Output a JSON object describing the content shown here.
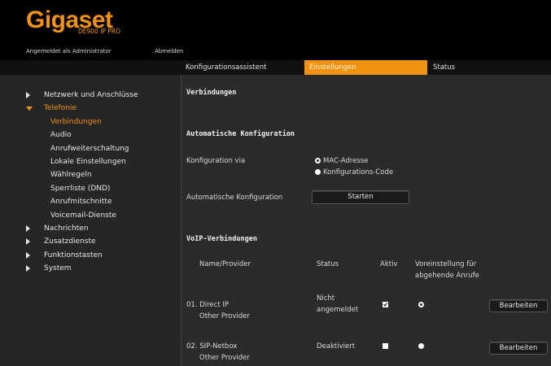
{
  "header": {
    "logo": "Gigaset",
    "model": "DE900 IP PRO",
    "login_info": "Angemeldet als Administrator",
    "logout": "Abmelden"
  },
  "tabs": [
    "Konfigurationsassistent",
    "Einstellungen",
    "Status"
  ],
  "sidebar": {
    "items": [
      {
        "label": "Netzwerk und Anschlüsse",
        "icon": "arrow-right-icon"
      },
      {
        "label": "Telefonie",
        "icon": "arrow-down-icon"
      },
      {
        "label": "Verbindungen"
      },
      {
        "label": "Audio"
      },
      {
        "label": "Anrufweiterschaltung"
      },
      {
        "label": "Lokale Einstellungen"
      },
      {
        "label": "Wählregeln"
      },
      {
        "label": "Sperrliste (DND)"
      },
      {
        "label": "Anrufmitschnitte"
      },
      {
        "label": "Voicemail-Dienste"
      },
      {
        "label": "Nachrichten",
        "icon": "arrow-right-icon"
      },
      {
        "label": "Zusatzdienste",
        "icon": "arrow-right-icon"
      },
      {
        "label": "Funktionstasten",
        "icon": "arrow-right-icon"
      },
      {
        "label": "System",
        "icon": "arrow-right-icon"
      }
    ]
  },
  "main": {
    "title": "Verbindungen",
    "auto_config": {
      "heading": "Automatische Konfiguration",
      "via_label": "Konfiguration via",
      "option_mac": "MAC-Adresse",
      "option_code": "Konfigurations-Code",
      "auto_label": "Automatische Konfiguration",
      "start_button": "Starten"
    },
    "voip": {
      "heading": "VoIP-Verbindungen",
      "col_name": "Name/Provider",
      "col_status": "Status",
      "col_active": "Aktiv",
      "col_default_1": "Voreinstellung für",
      "col_default_2": "abgehende Anrufe",
      "rows": [
        {
          "name": "01. Direct IP",
          "provider": "Other Provider",
          "status_1": "Nicht",
          "status_2": "angemeldet",
          "active": true,
          "default": true,
          "button": "Bearbeiten"
        },
        {
          "name": "02. SIP-Netbox",
          "provider": "Other Provider",
          "status_1": "Deaktiviert",
          "status_2": "",
          "active": false,
          "default": false,
          "button": "Bearbeiten"
        }
      ]
    }
  },
  "colors": {
    "accent": "#f29211",
    "background": "#2b2b2b",
    "header": "#000000"
  }
}
